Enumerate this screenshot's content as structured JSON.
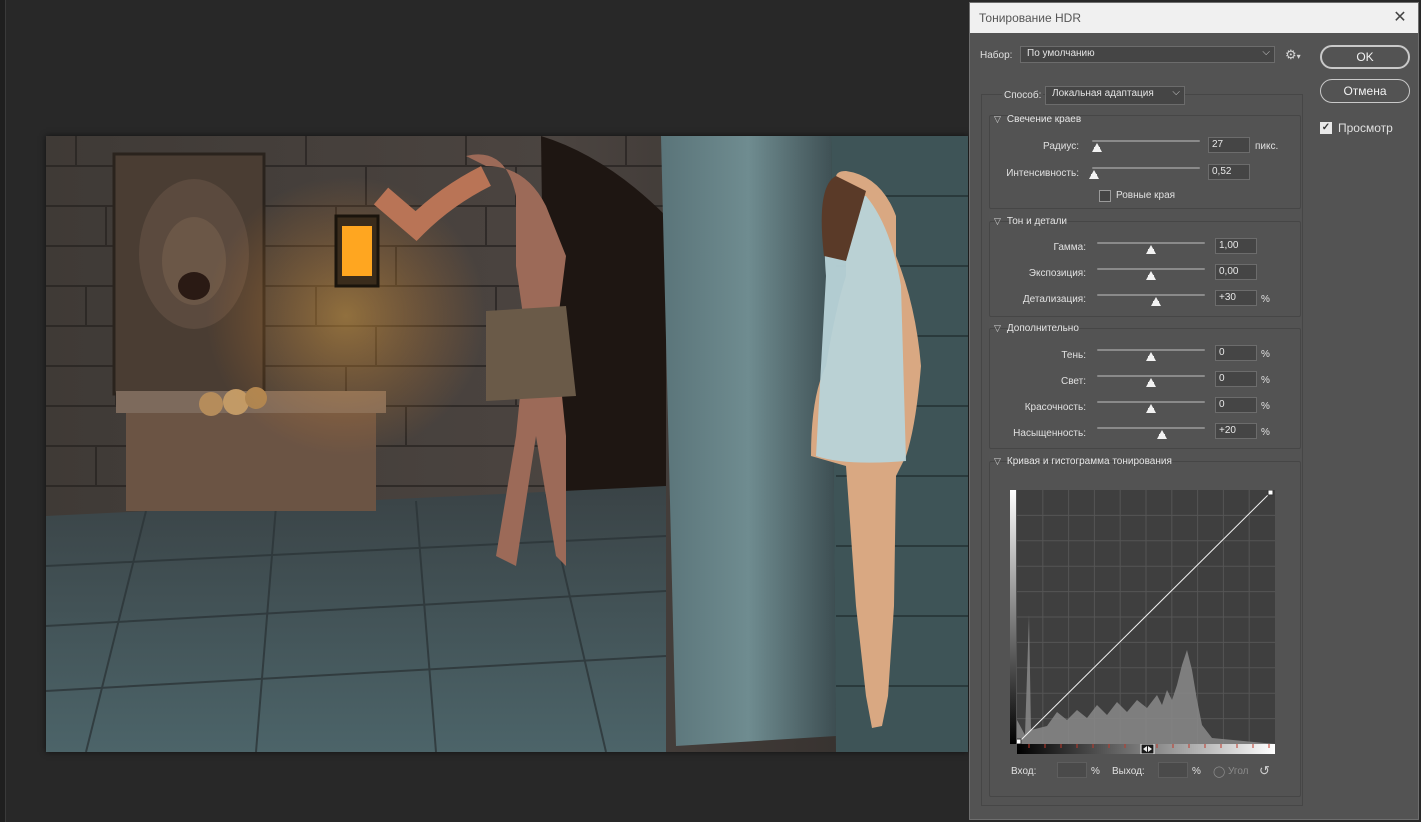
{
  "dialog": {
    "title": "Тонирование HDR",
    "close_icon": "close-icon",
    "preset_label": "Набор:",
    "preset_value": "По умолчанию",
    "ok_label": "OK",
    "cancel_label": "Отмена",
    "preview_label": "Просмотр",
    "preview_checked": true,
    "method_label": "Способ:",
    "method_value": "Локальная адаптация"
  },
  "edge_glow": {
    "title": "Свечение краев",
    "radius_label": "Радиус:",
    "radius_value": "27",
    "radius_unit": "пикс.",
    "radius_fraction": 0.05,
    "strength_label": "Интенсивность:",
    "strength_value": "0,52",
    "strength_fraction": 0.02,
    "smooth_label": "Ровные края",
    "smooth_checked": false
  },
  "tone_detail": {
    "title": "Тон и детали",
    "gamma_label": "Гамма:",
    "gamma_value": "1,00",
    "gamma_fraction": 0.5,
    "exposure_label": "Экспозиция:",
    "exposure_value": "0,00",
    "exposure_fraction": 0.5,
    "detail_label": "Детализация:",
    "detail_value": "+30",
    "detail_fraction": 0.55,
    "pct": "%"
  },
  "advanced": {
    "title": "Дополнительно",
    "shadow_label": "Тень:",
    "shadow_value": "0",
    "shadow_fraction": 0.5,
    "highlight_label": "Свет:",
    "highlight_value": "0",
    "highlight_fraction": 0.5,
    "vibrance_label": "Красочность:",
    "vibrance_value": "0",
    "vibrance_fraction": 0.5,
    "saturation_label": "Насыщенность:",
    "saturation_value": "+20",
    "saturation_fraction": 0.6,
    "pct": "%"
  },
  "curve": {
    "title": "Кривая и гистограмма тонирования",
    "input_label": "Вход:",
    "output_label": "Выход:",
    "pct": "%",
    "corner_label": "Угол"
  }
}
